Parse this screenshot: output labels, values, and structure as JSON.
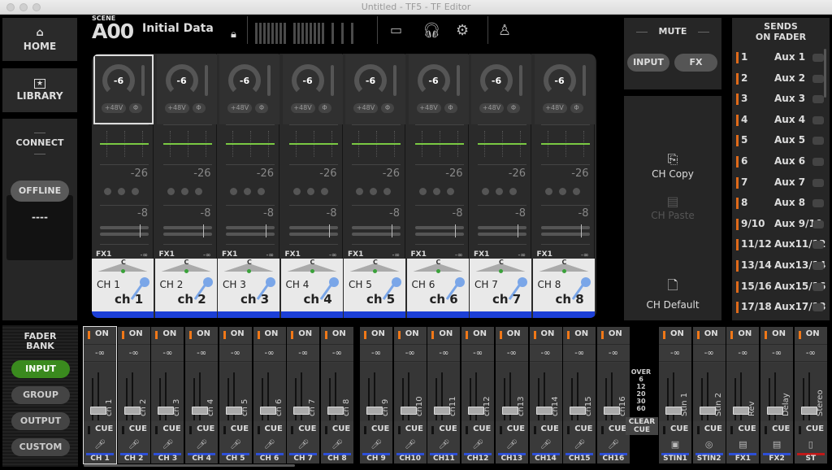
{
  "window": {
    "title": "Untitled - TF5 - TF Editor"
  },
  "nav": {
    "home": "HOME",
    "library": "LIBRARY",
    "home_icon": "home-icon",
    "library_icon": "star-icon"
  },
  "connect": {
    "title": "CONNECT",
    "offline": "OFFLINE",
    "status": "----"
  },
  "scene": {
    "label": "SCENE",
    "number": "A00",
    "name": "Initial Data"
  },
  "channels": [
    {
      "gain": "-6",
      "phantom": "+48V",
      "phase": "Φ",
      "dyn1": "-26",
      "dyn2": "-8",
      "fx": "FX1",
      "fx_val": "-∞",
      "pan": "C",
      "id": "CH 1",
      "name": "ch 1"
    },
    {
      "gain": "-6",
      "phantom": "+48V",
      "phase": "Φ",
      "dyn1": "-26",
      "dyn2": "-8",
      "fx": "FX1",
      "fx_val": "-∞",
      "pan": "C",
      "id": "CH 2",
      "name": "ch 2"
    },
    {
      "gain": "-6",
      "phantom": "+48V",
      "phase": "Φ",
      "dyn1": "-26",
      "dyn2": "-8",
      "fx": "FX1",
      "fx_val": "-∞",
      "pan": "C",
      "id": "CH 3",
      "name": "ch 3"
    },
    {
      "gain": "-6",
      "phantom": "+48V",
      "phase": "Φ",
      "dyn1": "-26",
      "dyn2": "-8",
      "fx": "FX1",
      "fx_val": "-∞",
      "pan": "C",
      "id": "CH 4",
      "name": "ch 4"
    },
    {
      "gain": "-6",
      "phantom": "+48V",
      "phase": "Φ",
      "dyn1": "-26",
      "dyn2": "-8",
      "fx": "FX1",
      "fx_val": "-∞",
      "pan": "C",
      "id": "CH 5",
      "name": "ch 5"
    },
    {
      "gain": "-6",
      "phantom": "+48V",
      "phase": "Φ",
      "dyn1": "-26",
      "dyn2": "-8",
      "fx": "FX1",
      "fx_val": "-∞",
      "pan": "C",
      "id": "CH 6",
      "name": "ch 6"
    },
    {
      "gain": "-6",
      "phantom": "+48V",
      "phase": "Φ",
      "dyn1": "-26",
      "dyn2": "-8",
      "fx": "FX1",
      "fx_val": "-∞",
      "pan": "C",
      "id": "CH 7",
      "name": "ch 7"
    },
    {
      "gain": "-6",
      "phantom": "+48V",
      "phase": "Φ",
      "dyn1": "-26",
      "dyn2": "-8",
      "fx": "FX1",
      "fx_val": "-∞",
      "pan": "C",
      "id": "CH 8",
      "name": "ch 8"
    }
  ],
  "mute": {
    "title": "MUTE",
    "input": "INPUT",
    "fx": "FX"
  },
  "edit": {
    "copy": "CH Copy",
    "paste": "CH Paste",
    "default": "CH Default"
  },
  "sends": {
    "title1": "SENDS",
    "title2": "ON FADER",
    "items": [
      {
        "num": "1",
        "name": "Aux 1"
      },
      {
        "num": "2",
        "name": "Aux 2"
      },
      {
        "num": "3",
        "name": "Aux 3"
      },
      {
        "num": "4",
        "name": "Aux 4"
      },
      {
        "num": "5",
        "name": "Aux 5"
      },
      {
        "num": "6",
        "name": "Aux 6"
      },
      {
        "num": "7",
        "name": "Aux 7"
      },
      {
        "num": "8",
        "name": "Aux 8"
      },
      {
        "num": "9/10",
        "name": "Aux 9/10"
      },
      {
        "num": "11/12",
        "name": "Aux11/12"
      },
      {
        "num": "13/14",
        "name": "Aux13/14"
      },
      {
        "num": "15/16",
        "name": "Aux15/16"
      },
      {
        "num": "17/18",
        "name": "Aux17/18"
      }
    ]
  },
  "fader_bank": {
    "title1": "FADER",
    "title2": "BANK",
    "buttons": [
      "INPUT",
      "GROUP",
      "OUTPUT",
      "CUSTOM"
    ],
    "active": "INPUT"
  },
  "faders": [
    {
      "name": "ch 1",
      "label": "CH 1"
    },
    {
      "name": "ch 2",
      "label": "CH 2"
    },
    {
      "name": "ch 3",
      "label": "CH 3"
    },
    {
      "name": "ch 4",
      "label": "CH 4"
    },
    {
      "name": "ch 5",
      "label": "CH 5"
    },
    {
      "name": "ch 6",
      "label": "CH 6"
    },
    {
      "name": "ch 7",
      "label": "CH 7"
    },
    {
      "name": "ch 8",
      "label": "CH 8"
    },
    {
      "name": "ch 9",
      "label": "CH 9"
    },
    {
      "name": "ch10",
      "label": "CH10"
    },
    {
      "name": "ch11",
      "label": "CH11"
    },
    {
      "name": "ch12",
      "label": "CH12"
    },
    {
      "name": "ch13",
      "label": "CH13"
    },
    {
      "name": "ch14",
      "label": "CH14"
    },
    {
      "name": "ch15",
      "label": "CH15"
    },
    {
      "name": "ch16",
      "label": "CH16"
    }
  ],
  "master_faders": [
    {
      "name": "StIn 1",
      "label": "STIN1",
      "icon": "▣"
    },
    {
      "name": "StIn 2",
      "label": "STIN2",
      "icon": "◎"
    },
    {
      "name": "Rev",
      "label": "FX1",
      "icon": "▤"
    },
    {
      "name": "Delay",
      "label": "FX2",
      "icon": "▤"
    },
    {
      "name": "Stereo",
      "label": "ST",
      "icon": "▯"
    }
  ],
  "fader_common": {
    "on": "ON",
    "level": "-∞",
    "cue": "CUE"
  },
  "meter_scale": [
    "OVER",
    "6",
    "12",
    "20",
    "30",
    "60"
  ],
  "clear_cue": "CLEAR CUE"
}
